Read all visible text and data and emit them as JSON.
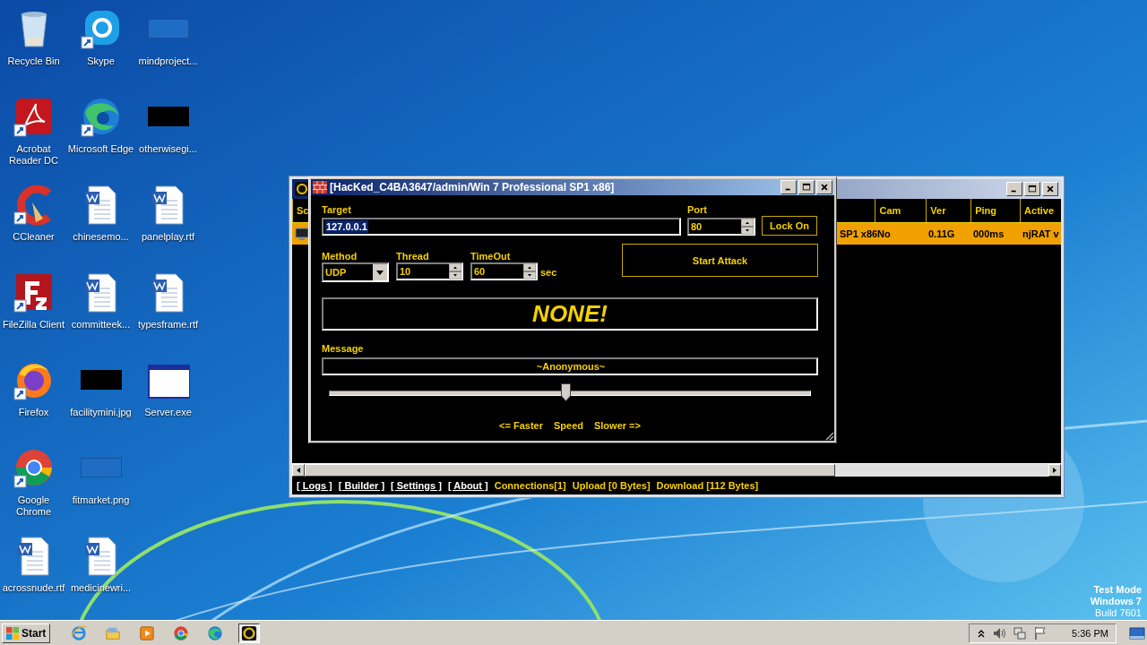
{
  "desktop_icons": [
    {
      "label": "Recycle Bin",
      "kind": "recycle",
      "shortcut": false
    },
    {
      "label": "Acrobat Reader DC",
      "kind": "pdf",
      "shortcut": true
    },
    {
      "label": "CCleaner",
      "kind": "cleaner",
      "shortcut": true
    },
    {
      "label": "FileZilla Client",
      "kind": "ftp",
      "shortcut": true
    },
    {
      "label": "Firefox",
      "kind": "firefox",
      "shortcut": true
    },
    {
      "label": "Google Chrome",
      "kind": "chrome",
      "shortcut": true
    },
    {
      "label": "acrossnude.rtf",
      "kind": "doc",
      "shortcut": false
    },
    {
      "label": "Skype",
      "kind": "chat",
      "shortcut": true
    },
    {
      "label": "Microsoft Edge",
      "kind": "edge",
      "shortcut": true
    },
    {
      "label": "chinesemo...",
      "kind": "doc",
      "shortcut": false
    },
    {
      "label": "committeek...",
      "kind": "doc",
      "shortcut": false
    },
    {
      "label": "facilitymini.jpg",
      "kind": "dark",
      "shortcut": false
    },
    {
      "label": "fitmarket.png",
      "kind": "blank",
      "shortcut": false
    },
    {
      "label": "medicinewri...",
      "kind": "doc",
      "shortcut": false
    },
    {
      "label": "mindproject...",
      "kind": "blank",
      "shortcut": false
    },
    {
      "label": "otherwisegi...",
      "kind": "dark",
      "shortcut": false
    },
    {
      "label": "panelplay.rtf",
      "kind": "doc",
      "shortcut": false
    },
    {
      "label": "typesframe.rtf",
      "kind": "doc",
      "shortcut": false
    },
    {
      "label": "Server.exe",
      "kind": "exe",
      "shortcut": false
    }
  ],
  "main_window": {
    "columns": [
      "Sc",
      "Cam",
      "Ver",
      "Ping",
      "Active"
    ],
    "row": {
      "selected": true,
      "cells": [
        "SP1 x86",
        "No",
        "0.11G",
        "000ms",
        "njRAT v"
      ]
    },
    "links": [
      "[ Logs ]",
      "[ Builder ]",
      "[ Settings ]",
      "[ About ]"
    ],
    "stats": [
      "Connections[1]",
      "Upload [0 Bytes]",
      "Download [112 Bytes]"
    ]
  },
  "attack_window": {
    "title": "[HacKed_C4BA3647/admin/Win 7 Professional SP1 x86]",
    "target": {
      "label": "Target",
      "value": "127.0.0.1",
      "text_selected": true
    },
    "port": {
      "label": "Port",
      "value": "80"
    },
    "lock_button": "Lock On",
    "method": {
      "label": "Method",
      "value": "UDP"
    },
    "thread": {
      "label": "Thread",
      "value": "10"
    },
    "timeout": {
      "label": "TimeOut",
      "value": "60",
      "unit": "sec"
    },
    "start_button": "Start Attack",
    "status": "NONE!",
    "message": {
      "label": "Message",
      "value": "~Anonymous~"
    },
    "speed": {
      "level": 0.49,
      "faster": "<= Faster",
      "label": "Speed",
      "slower": "Slower =>"
    }
  },
  "taskbar": {
    "start": "Start",
    "apps": [
      {
        "kind": "ie",
        "selected": false
      },
      {
        "kind": "folder",
        "selected": false
      },
      {
        "kind": "media",
        "selected": false
      },
      {
        "kind": "chrome",
        "selected": false
      },
      {
        "kind": "edge",
        "selected": false
      },
      {
        "kind": "rat",
        "selected": true
      }
    ],
    "clock": "5:36 PM"
  },
  "os_notice": [
    "Test Mode",
    "Windows 7",
    "Build 7601"
  ]
}
